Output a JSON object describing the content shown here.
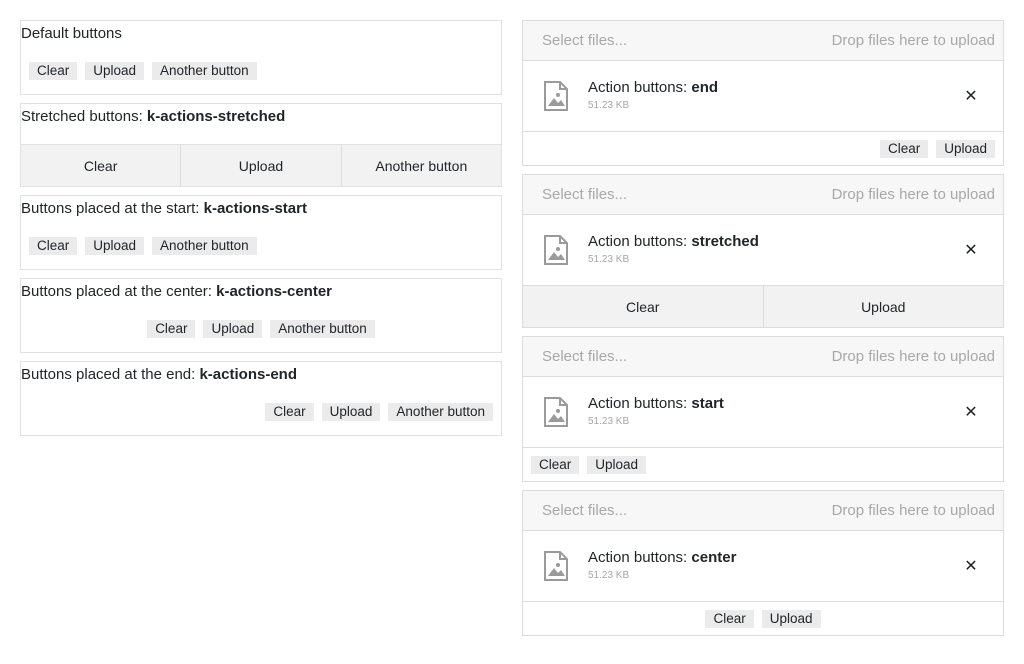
{
  "left": {
    "default": {
      "title": "Default buttons",
      "buttons": [
        "Clear",
        "Upload",
        "Another button"
      ]
    },
    "stretched": {
      "title": "Stretched buttons: ",
      "title_code": "k-actions-stretched",
      "buttons": [
        "Clear",
        "Upload",
        "Another button"
      ]
    },
    "start": {
      "title": "Buttons placed at the start: ",
      "title_code": "k-actions-start",
      "buttons": [
        "Clear",
        "Upload",
        "Another button"
      ]
    },
    "center": {
      "title": "Buttons placed at the center: ",
      "title_code": "k-actions-center",
      "buttons": [
        "Clear",
        "Upload",
        "Another button"
      ]
    },
    "end": {
      "title": "Buttons placed at the end: ",
      "title_code": "k-actions-end",
      "buttons": [
        "Clear",
        "Upload",
        "Another button"
      ]
    }
  },
  "uploads": {
    "select_label": "Select files...",
    "drop_label": "Drop files here to upload",
    "file_size": "51.23 KB",
    "file_prefix": "Action buttons: ",
    "close_glyph": "✕",
    "end": {
      "name": "end",
      "buttons": [
        "Clear",
        "Upload"
      ]
    },
    "stretched": {
      "name": "stretched",
      "buttons": [
        "Clear",
        "Upload"
      ]
    },
    "start": {
      "name": "start",
      "buttons": [
        "Clear",
        "Upload"
      ]
    },
    "center": {
      "name": "center",
      "buttons": [
        "Clear",
        "Upload"
      ]
    }
  },
  "colors": {
    "button_bg": "#ebebeb",
    "border": "#dcdcdc",
    "placeholder": "#a8a8a8"
  }
}
